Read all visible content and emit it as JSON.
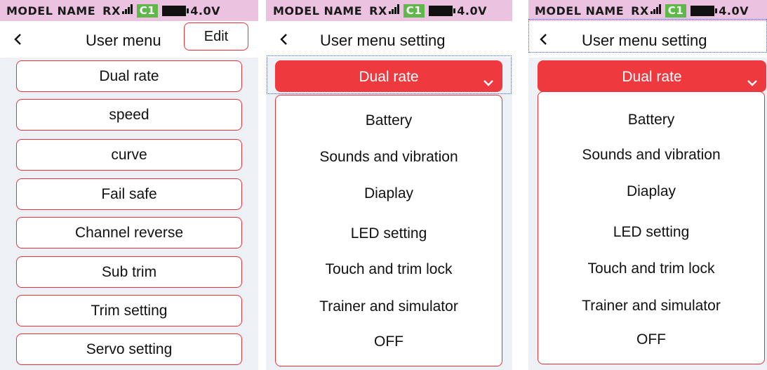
{
  "status_bar": {
    "model_name": "MODEL NAME",
    "rx": "RX",
    "channel": "C1",
    "voltage": "4.0V"
  },
  "panel1": {
    "title": "User menu",
    "edit_label": "Edit",
    "items": [
      "Dual rate",
      "speed",
      "curve",
      "Fail safe",
      "Channel reverse",
      "Sub trim",
      "Trim setting",
      "Servo setting"
    ]
  },
  "panel2": {
    "title": "User menu setting",
    "selected": "Dual rate",
    "options": [
      "Battery",
      "Sounds and vibration",
      "Diaplay",
      "LED setting",
      "Touch and trim lock",
      "Trainer and simulator",
      "OFF"
    ]
  },
  "panel3": {
    "title": "User menu setting",
    "selected": "Dual rate",
    "options": [
      "Battery",
      "Sounds and vibration",
      "Diaplay",
      "LED setting",
      "Touch and trim lock",
      "Trainer and simulator",
      "OFF"
    ]
  },
  "colors": {
    "status_bg": "#ebc3e0",
    "accent_red": "#ee3a3e",
    "border_red": "#e8313a",
    "content_bg": "#edf0f5",
    "badge_green": "#5fb94a",
    "focus_dots": "#4a63b8"
  }
}
